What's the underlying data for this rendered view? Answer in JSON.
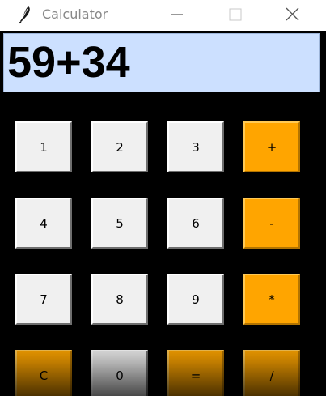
{
  "window": {
    "title": "Calculator",
    "icon": "feather-icon",
    "controls": [
      "minimize-icon",
      "maximize-icon",
      "close-icon"
    ]
  },
  "display": {
    "value": "59+34",
    "background": "#cce0ff"
  },
  "keypad": {
    "rows": [
      [
        {
          "label": "1"
        },
        {
          "label": "2"
        },
        {
          "label": "3"
        },
        {
          "label": "+"
        }
      ],
      [
        {
          "label": "4"
        },
        {
          "label": "5"
        },
        {
          "label": "6"
        },
        {
          "label": "-"
        }
      ],
      [
        {
          "label": "7"
        },
        {
          "label": "8"
        },
        {
          "label": "9"
        },
        {
          "label": "*"
        }
      ],
      [
        {
          "label": "C"
        },
        {
          "label": "0"
        },
        {
          "label": "="
        },
        {
          "label": "/"
        }
      ]
    ]
  },
  "colors": {
    "number_key": "#f0f0f0",
    "operator_key": "#ffa500",
    "background": "#000000"
  }
}
